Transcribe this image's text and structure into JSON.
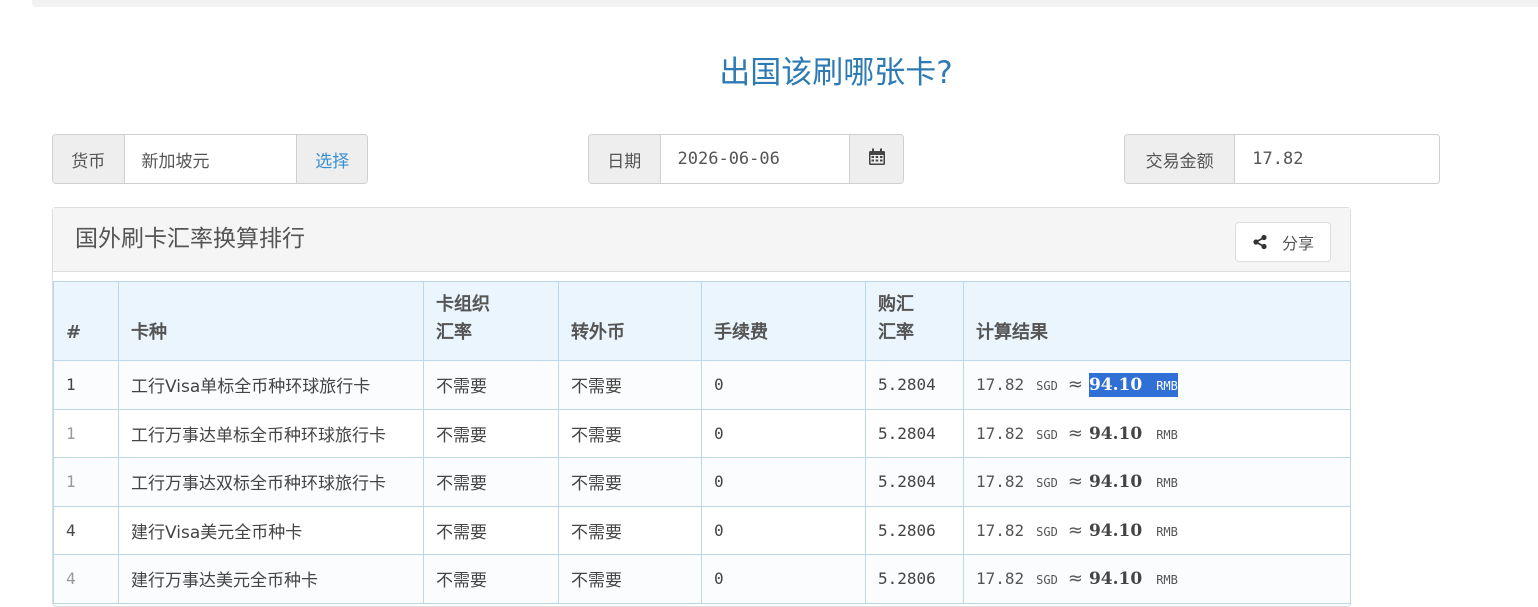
{
  "page": {
    "title": "出国该刷哪张卡?"
  },
  "inputs": {
    "currency": {
      "label": "货币",
      "value": "新加坡元",
      "button": "选择"
    },
    "date": {
      "label": "日期",
      "value": "2026-06-06",
      "icon": "calendar-icon"
    },
    "amount": {
      "label": "交易金额",
      "value": "17.82"
    }
  },
  "panel": {
    "title": "国外刷卡汇率换算排行",
    "share_label": "分享",
    "share_icon": "share-icon"
  },
  "table": {
    "headers": [
      "#",
      "卡种",
      "卡组织\n汇率",
      "转外币",
      "手续费",
      "购汇\n汇率",
      "计算结果"
    ],
    "rows": [
      {
        "rank": "1",
        "card": "工行Visa单标全币种环球旅行卡",
        "org_rate": "不需要",
        "convert": "不需要",
        "fee": "0",
        "buy_rate": "5.2804",
        "amount": "17.82",
        "currency": "SGD",
        "approx": "≈",
        "result": "94.10",
        "unit": "RMB"
      },
      {
        "rank": "1",
        "card": "工行万事达单标全币种环球旅行卡",
        "org_rate": "不需要",
        "convert": "不需要",
        "fee": "0",
        "buy_rate": "5.2804",
        "amount": "17.82",
        "currency": "SGD",
        "approx": "≈",
        "result": "94.10",
        "unit": "RMB"
      },
      {
        "rank": "1",
        "card": "工行万事达双标全币种环球旅行卡",
        "org_rate": "不需要",
        "convert": "不需要",
        "fee": "0",
        "buy_rate": "5.2804",
        "amount": "17.82",
        "currency": "SGD",
        "approx": "≈",
        "result": "94.10",
        "unit": "RMB"
      },
      {
        "rank": "4",
        "card": "建行Visa美元全币种卡",
        "org_rate": "不需要",
        "convert": "不需要",
        "fee": "0",
        "buy_rate": "5.2806",
        "amount": "17.82",
        "currency": "SGD",
        "approx": "≈",
        "result": "94.10",
        "unit": "RMB"
      },
      {
        "rank": "4",
        "card": "建行万事达美元全币种卡",
        "org_rate": "不需要",
        "convert": "不需要",
        "fee": "0",
        "buy_rate": "5.2806",
        "amount": "17.82",
        "currency": "SGD",
        "approx": "≈",
        "result": "94.10",
        "unit": "RMB"
      }
    ]
  },
  "colors": {
    "title": "#2e7bb3",
    "header_bg": "#eaf5fd",
    "border": "#bcd6ea",
    "selection": "#2f6fd6",
    "link": "#3a8fd1"
  }
}
